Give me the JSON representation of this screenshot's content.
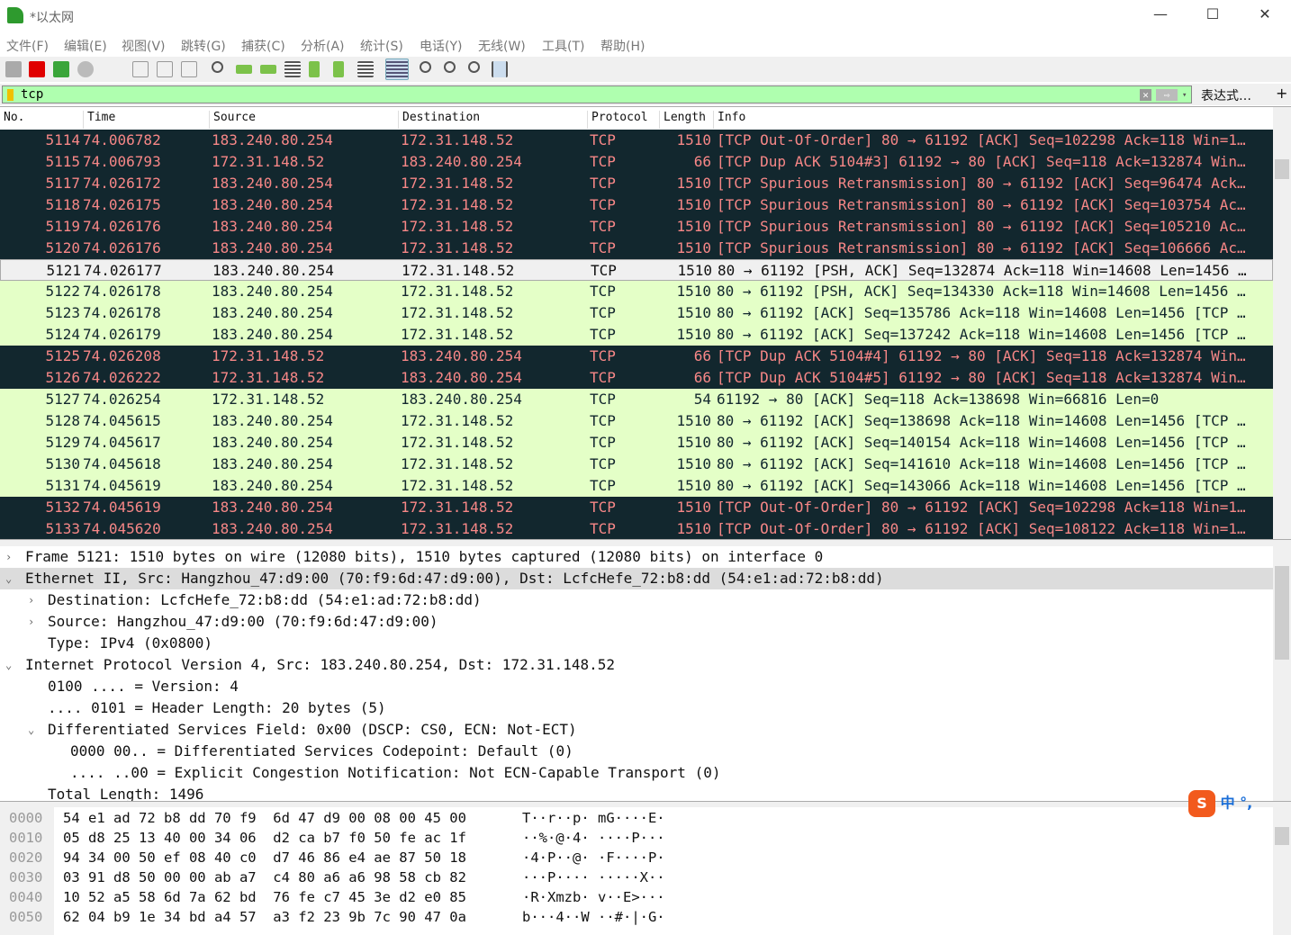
{
  "window": {
    "title": "*以太网",
    "minimize": "—",
    "maximize": "☐",
    "close": "✕"
  },
  "menu": [
    "文件(F)",
    "编辑(E)",
    "视图(V)",
    "跳转(G)",
    "捕获(C)",
    "分析(A)",
    "统计(S)",
    "电话(Y)",
    "无线(W)",
    "工具(T)",
    "帮助(H)"
  ],
  "filter": {
    "value": "tcp",
    "clear": "✕",
    "apply": "⇨",
    "dropdown": "▾",
    "expression": "表达式…",
    "add": "+"
  },
  "columns": [
    "No.",
    "Time",
    "Source",
    "Destination",
    "Protocol",
    "Length",
    "Info"
  ],
  "colors": {
    "dark_bg": "#12272e",
    "dark_fg": "#f78787",
    "green_bg": "#e4ffc7",
    "filter_bg": "#afffaf"
  },
  "packets": [
    {
      "no": "5114",
      "time": "74.006782",
      "src": "183.240.80.254",
      "dst": "172.31.148.52",
      "proto": "TCP",
      "len": "1510",
      "info": "[TCP Out-Of-Order] 80 → 61192 [ACK] Seq=102298 Ack=118 Win=1…",
      "style": "dark"
    },
    {
      "no": "5115",
      "time": "74.006793",
      "src": "172.31.148.52",
      "dst": "183.240.80.254",
      "proto": "TCP",
      "len": "66",
      "info": "[TCP Dup ACK 5104#3] 61192 → 80 [ACK] Seq=118 Ack=132874 Win…",
      "style": "dark"
    },
    {
      "no": "5117",
      "time": "74.026172",
      "src": "183.240.80.254",
      "dst": "172.31.148.52",
      "proto": "TCP",
      "len": "1510",
      "info": "[TCP Spurious Retransmission] 80 → 61192 [ACK] Seq=96474 Ack…",
      "style": "dark"
    },
    {
      "no": "5118",
      "time": "74.026175",
      "src": "183.240.80.254",
      "dst": "172.31.148.52",
      "proto": "TCP",
      "len": "1510",
      "info": "[TCP Spurious Retransmission] 80 → 61192 [ACK] Seq=103754 Ac…",
      "style": "dark"
    },
    {
      "no": "5119",
      "time": "74.026176",
      "src": "183.240.80.254",
      "dst": "172.31.148.52",
      "proto": "TCP",
      "len": "1510",
      "info": "[TCP Spurious Retransmission] 80 → 61192 [ACK] Seq=105210 Ac…",
      "style": "dark"
    },
    {
      "no": "5120",
      "time": "74.026176",
      "src": "183.240.80.254",
      "dst": "172.31.148.52",
      "proto": "TCP",
      "len": "1510",
      "info": "[TCP Spurious Retransmission] 80 → 61192 [ACK] Seq=106666 Ac…",
      "style": "dark"
    },
    {
      "no": "5121",
      "time": "74.026177",
      "src": "183.240.80.254",
      "dst": "172.31.148.52",
      "proto": "TCP",
      "len": "1510",
      "info": "80 → 61192 [PSH, ACK] Seq=132874 Ack=118 Win=14608 Len=1456 …",
      "style": "sel"
    },
    {
      "no": "5122",
      "time": "74.026178",
      "src": "183.240.80.254",
      "dst": "172.31.148.52",
      "proto": "TCP",
      "len": "1510",
      "info": "80 → 61192 [PSH, ACK] Seq=134330 Ack=118 Win=14608 Len=1456 …",
      "style": "green"
    },
    {
      "no": "5123",
      "time": "74.026178",
      "src": "183.240.80.254",
      "dst": "172.31.148.52",
      "proto": "TCP",
      "len": "1510",
      "info": "80 → 61192 [ACK] Seq=135786 Ack=118 Win=14608 Len=1456 [TCP …",
      "style": "green"
    },
    {
      "no": "5124",
      "time": "74.026179",
      "src": "183.240.80.254",
      "dst": "172.31.148.52",
      "proto": "TCP",
      "len": "1510",
      "info": "80 → 61192 [ACK] Seq=137242 Ack=118 Win=14608 Len=1456 [TCP …",
      "style": "green"
    },
    {
      "no": "5125",
      "time": "74.026208",
      "src": "172.31.148.52",
      "dst": "183.240.80.254",
      "proto": "TCP",
      "len": "66",
      "info": "[TCP Dup ACK 5104#4] 61192 → 80 [ACK] Seq=118 Ack=132874 Win…",
      "style": "dark"
    },
    {
      "no": "5126",
      "time": "74.026222",
      "src": "172.31.148.52",
      "dst": "183.240.80.254",
      "proto": "TCP",
      "len": "66",
      "info": "[TCP Dup ACK 5104#5] 61192 → 80 [ACK] Seq=118 Ack=132874 Win…",
      "style": "dark"
    },
    {
      "no": "5127",
      "time": "74.026254",
      "src": "172.31.148.52",
      "dst": "183.240.80.254",
      "proto": "TCP",
      "len": "54",
      "info": "61192 → 80 [ACK] Seq=118 Ack=138698 Win=66816 Len=0",
      "style": "green"
    },
    {
      "no": "5128",
      "time": "74.045615",
      "src": "183.240.80.254",
      "dst": "172.31.148.52",
      "proto": "TCP",
      "len": "1510",
      "info": "80 → 61192 [ACK] Seq=138698 Ack=118 Win=14608 Len=1456 [TCP …",
      "style": "green"
    },
    {
      "no": "5129",
      "time": "74.045617",
      "src": "183.240.80.254",
      "dst": "172.31.148.52",
      "proto": "TCP",
      "len": "1510",
      "info": "80 → 61192 [ACK] Seq=140154 Ack=118 Win=14608 Len=1456 [TCP …",
      "style": "green"
    },
    {
      "no": "5130",
      "time": "74.045618",
      "src": "183.240.80.254",
      "dst": "172.31.148.52",
      "proto": "TCP",
      "len": "1510",
      "info": "80 → 61192 [ACK] Seq=141610 Ack=118 Win=14608 Len=1456 [TCP …",
      "style": "green"
    },
    {
      "no": "5131",
      "time": "74.045619",
      "src": "183.240.80.254",
      "dst": "172.31.148.52",
      "proto": "TCP",
      "len": "1510",
      "info": "80 → 61192 [ACK] Seq=143066 Ack=118 Win=14608 Len=1456 [TCP …",
      "style": "green"
    },
    {
      "no": "5132",
      "time": "74.045619",
      "src": "183.240.80.254",
      "dst": "172.31.148.52",
      "proto": "TCP",
      "len": "1510",
      "info": "[TCP Out-Of-Order] 80 → 61192 [ACK] Seq=102298 Ack=118 Win=1…",
      "style": "dark"
    },
    {
      "no": "5133",
      "time": "74.045620",
      "src": "183.240.80.254",
      "dst": "172.31.148.52",
      "proto": "TCP",
      "len": "1510",
      "info": "[TCP Out-Of-Order] 80 → 61192 [ACK] Seq=108122 Ack=118 Win=1…",
      "style": "dark"
    }
  ],
  "details": [
    {
      "indent": 0,
      "arrow": "›",
      "text": "Frame 5121: 1510 bytes on wire (12080 bits), 1510 bytes captured (12080 bits) on interface 0"
    },
    {
      "indent": 0,
      "arrow": "⌄",
      "text": "Ethernet II, Src: Hangzhou_47:d9:00 (70:f9:6d:47:d9:00), Dst: LcfcHefe_72:b8:dd (54:e1:ad:72:b8:dd)",
      "hl": true
    },
    {
      "indent": 1,
      "arrow": "›",
      "text": "Destination: LcfcHefe_72:b8:dd (54:e1:ad:72:b8:dd)"
    },
    {
      "indent": 1,
      "arrow": "›",
      "text": "Source: Hangzhou_47:d9:00 (70:f9:6d:47:d9:00)"
    },
    {
      "indent": 1,
      "arrow": "",
      "text": "Type: IPv4 (0x0800)"
    },
    {
      "indent": 0,
      "arrow": "⌄",
      "text": "Internet Protocol Version 4, Src: 183.240.80.254, Dst: 172.31.148.52"
    },
    {
      "indent": 1,
      "arrow": "",
      "text": "0100 .... = Version: 4"
    },
    {
      "indent": 1,
      "arrow": "",
      "text": ".... 0101 = Header Length: 20 bytes (5)"
    },
    {
      "indent": 1,
      "arrow": "⌄",
      "text": "Differentiated Services Field: 0x00 (DSCP: CS0, ECN: Not-ECT)"
    },
    {
      "indent": 2,
      "arrow": "",
      "text": "0000 00.. = Differentiated Services Codepoint: Default (0)"
    },
    {
      "indent": 2,
      "arrow": "",
      "text": ".... ..00 = Explicit Congestion Notification: Not ECN-Capable Transport (0)"
    },
    {
      "indent": 1,
      "arrow": "",
      "text": "Total Length: 1496"
    }
  ],
  "hex": [
    {
      "off": "0000",
      "bytes": "54 e1 ad 72 b8 dd 70 f9  6d 47 d9 00 08 00 45 00",
      "ascii": "T··r··p· mG····E·"
    },
    {
      "off": "0010",
      "bytes": "05 d8 25 13 40 00 34 06  d2 ca b7 f0 50 fe ac 1f",
      "ascii": "··%·@·4· ····P···"
    },
    {
      "off": "0020",
      "bytes": "94 34 00 50 ef 08 40 c0  d7 46 86 e4 ae 87 50 18",
      "ascii": "·4·P··@· ·F····P·"
    },
    {
      "off": "0030",
      "bytes": "03 91 d8 50 00 00 ab a7  c4 80 a6 a6 98 58 cb 82",
      "ascii": "···P···· ·····X··"
    },
    {
      "off": "0040",
      "bytes": "10 52 a5 58 6d 7a 62 bd  76 fe c7 45 3e d2 e0 85",
      "ascii": "·R·Xmzb· v··E>···"
    },
    {
      "off": "0050",
      "bytes": "62 04 b9 1e 34 bd a4 57  a3 f2 23 9b 7c 90 47 0a",
      "ascii": "b···4··W ··#·|·G·"
    }
  ],
  "ime": {
    "label": "中 °,"
  }
}
